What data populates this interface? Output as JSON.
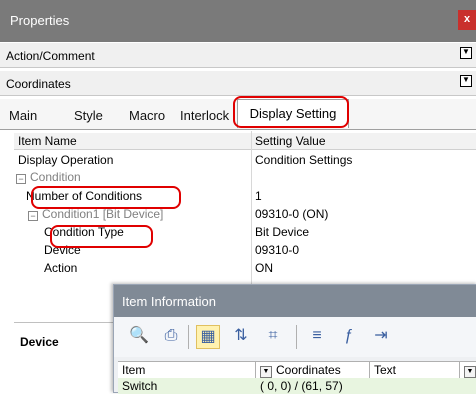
{
  "window": {
    "title": "Properties",
    "close_label": "x"
  },
  "sections": {
    "action_comment": "Action/Comment",
    "coordinates": "Coordinates"
  },
  "tabs": [
    {
      "label": "Main"
    },
    {
      "label": "Style"
    },
    {
      "label": "Macro"
    },
    {
      "label": "Interlock"
    },
    {
      "label": "Display Setting"
    }
  ],
  "grid": {
    "headers": {
      "name": "Item Name",
      "value": "Setting Value"
    },
    "rows": [
      {
        "name": "Display Operation",
        "value": "Condition Settings"
      },
      {
        "name": "Condition",
        "value": ""
      },
      {
        "name": "Number of Conditions",
        "value": "1"
      },
      {
        "name": "Condition1 [Bit Device]",
        "value": "09310-0 (ON)"
      },
      {
        "name": "Condition Type",
        "value": "Bit Device"
      },
      {
        "name": "Device",
        "value": "09310-0"
      },
      {
        "name": "Action",
        "value": "ON"
      }
    ]
  },
  "device_panel": {
    "label": "Device"
  },
  "item_info": {
    "title": "Item Information",
    "toolbar": [
      "preview-icon",
      "print-icon",
      "grid-view-icon",
      "sort-icon",
      "select-frame-icon",
      "filter-icon",
      "function-icon",
      "export-icon"
    ],
    "columns": [
      "Item",
      "Coordinates",
      "Text"
    ],
    "row": {
      "item": "Switch",
      "coords": "( 0, 0) / (61, 57)"
    }
  }
}
